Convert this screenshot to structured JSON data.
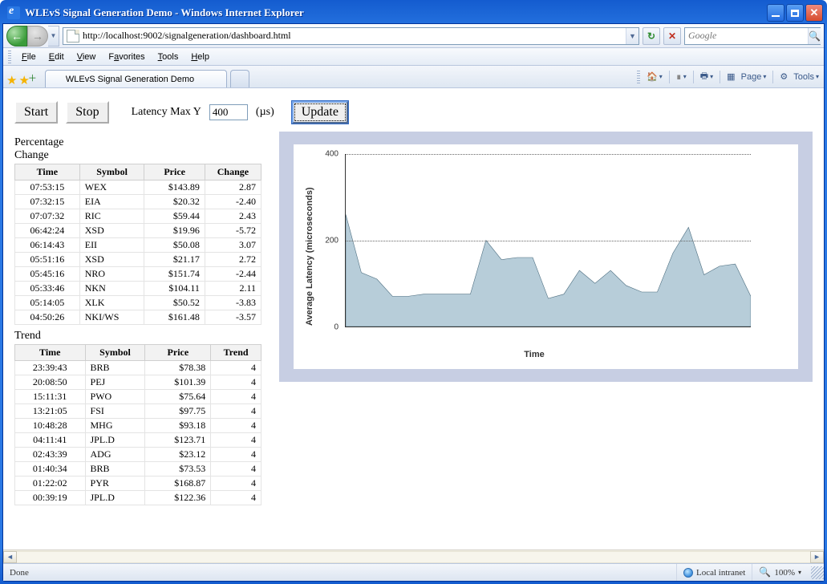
{
  "window": {
    "title": "WLEvS Signal Generation Demo - Windows Internet Explorer"
  },
  "nav": {
    "url": "http://localhost:9002/signalgeneration/dashboard.html",
    "search_placeholder": "Google"
  },
  "menu": {
    "file": "File",
    "edit": "Edit",
    "view": "View",
    "favorites": "Favorites",
    "tools": "Tools",
    "help": "Help"
  },
  "tab": {
    "title": "WLEvS Signal Generation Demo"
  },
  "command_bar": {
    "page": "Page",
    "tools": "Tools"
  },
  "controls": {
    "start": "Start",
    "stop": "Stop",
    "latency_label": "Latency Max Y",
    "latency_value": "400",
    "latency_unit": "(µs)",
    "update": "Update"
  },
  "percentage_change": {
    "title_line1": "Percentage",
    "title_line2": "Change",
    "headers": {
      "time": "Time",
      "symbol": "Symbol",
      "price": "Price",
      "change": "Change"
    },
    "rows": [
      {
        "time": "07:53:15",
        "symbol": "WEX",
        "price": "$143.89",
        "change": "2.87"
      },
      {
        "time": "07:32:15",
        "symbol": "EIA",
        "price": "$20.32",
        "change": "-2.40"
      },
      {
        "time": "07:07:32",
        "symbol": "RIC",
        "price": "$59.44",
        "change": "2.43"
      },
      {
        "time": "06:42:24",
        "symbol": "XSD",
        "price": "$19.96",
        "change": "-5.72"
      },
      {
        "time": "06:14:43",
        "symbol": "EII",
        "price": "$50.08",
        "change": "3.07"
      },
      {
        "time": "05:51:16",
        "symbol": "XSD",
        "price": "$21.17",
        "change": "2.72"
      },
      {
        "time": "05:45:16",
        "symbol": "NRO",
        "price": "$151.74",
        "change": "-2.44"
      },
      {
        "time": "05:33:46",
        "symbol": "NKN",
        "price": "$104.11",
        "change": "2.11"
      },
      {
        "time": "05:14:05",
        "symbol": "XLK",
        "price": "$50.52",
        "change": "-3.83"
      },
      {
        "time": "04:50:26",
        "symbol": "NKI/WS",
        "price": "$161.48",
        "change": "-3.57"
      }
    ]
  },
  "trend": {
    "title": "Trend",
    "headers": {
      "time": "Time",
      "symbol": "Symbol",
      "price": "Price",
      "trend": "Trend"
    },
    "rows": [
      {
        "time": "23:39:43",
        "symbol": "BRB",
        "price": "$78.38",
        "trend": "4"
      },
      {
        "time": "20:08:50",
        "symbol": "PEJ",
        "price": "$101.39",
        "trend": "4"
      },
      {
        "time": "15:11:31",
        "symbol": "PWO",
        "price": "$75.64",
        "trend": "4"
      },
      {
        "time": "13:21:05",
        "symbol": "FSI",
        "price": "$97.75",
        "trend": "4"
      },
      {
        "time": "10:48:28",
        "symbol": "MHG",
        "price": "$93.18",
        "trend": "4"
      },
      {
        "time": "04:11:41",
        "symbol": "JPL.D",
        "price": "$123.71",
        "trend": "4"
      },
      {
        "time": "02:43:39",
        "symbol": "ADG",
        "price": "$23.12",
        "trend": "4"
      },
      {
        "time": "01:40:34",
        "symbol": "BRB",
        "price": "$73.53",
        "trend": "4"
      },
      {
        "time": "01:22:02",
        "symbol": "PYR",
        "price": "$168.87",
        "trend": "4"
      },
      {
        "time": "00:39:19",
        "symbol": "JPL.D",
        "price": "$122.36",
        "trend": "4"
      }
    ]
  },
  "chart_data": {
    "type": "area",
    "title": "",
    "xlabel": "Time",
    "ylabel": "Average Latency (microseconds)",
    "ylim": [
      0,
      400
    ],
    "yticks": [
      0,
      200,
      400
    ],
    "values": [
      260,
      125,
      110,
      70,
      70,
      75,
      75,
      75,
      75,
      200,
      155,
      160,
      160,
      65,
      75,
      130,
      100,
      130,
      95,
      80,
      80,
      170,
      230,
      120,
      140,
      145,
      70
    ]
  },
  "statusbar": {
    "status": "Done",
    "zone": "Local intranet",
    "zoom": "100%"
  }
}
